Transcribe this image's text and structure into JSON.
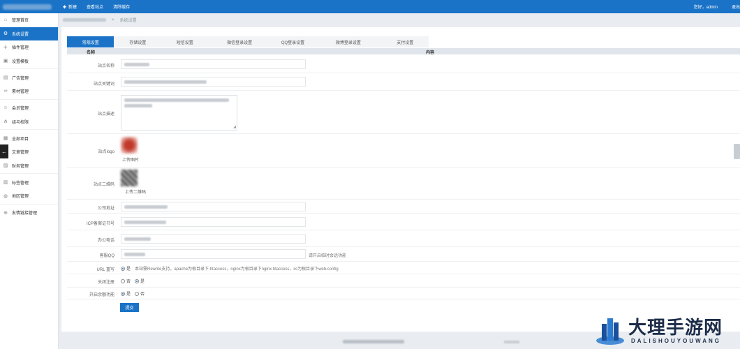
{
  "topbar": {
    "nav": [
      {
        "icon": "plus-icon",
        "label": "新建"
      },
      {
        "label": "查看站点"
      },
      {
        "label": "清除缓存"
      }
    ],
    "greeting": "您好，admin",
    "logout_fragment": "退出"
  },
  "sidebar": {
    "items": [
      {
        "icon": "home-icon",
        "label": "管理首页"
      },
      {
        "icon": "gear-icon",
        "label": "系统设置",
        "active": true
      },
      {
        "icon": "plugin-icon",
        "label": "插件管理"
      },
      {
        "icon": "template-icon",
        "label": "设置模板"
      },
      {
        "icon": "ad-icon",
        "label": "广告管理"
      },
      {
        "icon": "link-icon",
        "label": "素材管理"
      },
      {
        "icon": "user-icon",
        "label": "会员管理"
      },
      {
        "icon": "group-icon",
        "label": "组与权限"
      },
      {
        "icon": "project-icon",
        "label": "全部项目"
      },
      {
        "icon": "article-icon",
        "label": "文章管理"
      },
      {
        "icon": "finance-icon",
        "label": "财务管理"
      },
      {
        "icon": "tag-icon",
        "label": "标签管理"
      },
      {
        "icon": "region-icon",
        "label": "地区管理"
      },
      {
        "icon": "friend-link-icon",
        "label": "友情链接管理"
      }
    ]
  },
  "breadcrumb": {
    "separator": ">",
    "current": "系统设置"
  },
  "tabs": [
    "常规设置",
    "存储设置",
    "短信设置",
    "微信登录设置",
    "QQ登录设置",
    "微博登录设置",
    "支付设置"
  ],
  "table": {
    "header_name": "名称",
    "header_content": "内容"
  },
  "form": {
    "site_name": "站点名称",
    "site_keywords": "站点关键词",
    "site_description": "站点描述",
    "site_logo": "站点logo",
    "upload_image": "上传图片",
    "site_qrcode": "站点二维码",
    "upload_qrcode": "上传二维码",
    "company_address": "公司地址",
    "icp": "ICP备案证书号",
    "office_phone": "办公电话",
    "service_qq": "客服QQ",
    "qq_hint": "请开启临时会话功能",
    "url_rewrite": "URL 重写",
    "url_options": [
      "是",
      "否"
    ],
    "url_hint": "本站需Rewrite支持，apache为根目录下.htaccess，nginx为根目录下nginx.htaccess，iis为根目录下web.config",
    "captcha": "关闭注册",
    "captcha_options": [
      "否",
      "是"
    ],
    "cache": "开启余额功能",
    "cache_options": [
      "是",
      "否"
    ],
    "submit": "提交"
  },
  "watermark": {
    "cn": "大理手游网",
    "en": "DALISHOUYOUWANG"
  },
  "colors": {
    "primary": "#1a73c7",
    "page_bg": "#e9edf1"
  }
}
